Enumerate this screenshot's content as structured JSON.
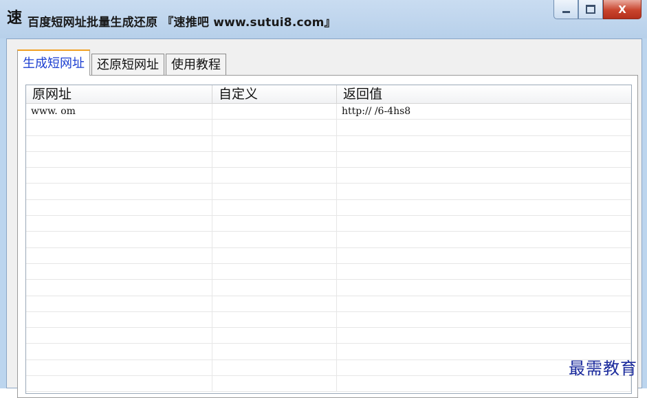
{
  "window": {
    "icon_glyph": "速",
    "title": "百度短网址批量生成还原 『速推吧 www.sutui8.com』",
    "buttons": {
      "minimize": "minimize-icon",
      "maximize": "maximize-icon",
      "close_label": "X"
    }
  },
  "tabs": [
    {
      "label": "生成短网址",
      "active": true
    },
    {
      "label": "还原短网址",
      "active": false
    },
    {
      "label": "使用教程",
      "active": false
    }
  ],
  "table": {
    "columns": [
      "原网址",
      "自定义",
      "返回值"
    ],
    "rows": [
      [
        "www.          om",
        "",
        "http://             /6-4hs8"
      ]
    ]
  },
  "watermark": "最需教育",
  "colors": {
    "active_tab_text": "#1c3fd1",
    "active_tab_accent": "#f1a021",
    "close_button": "#c9442d",
    "watermark": "#1a2a9c"
  }
}
